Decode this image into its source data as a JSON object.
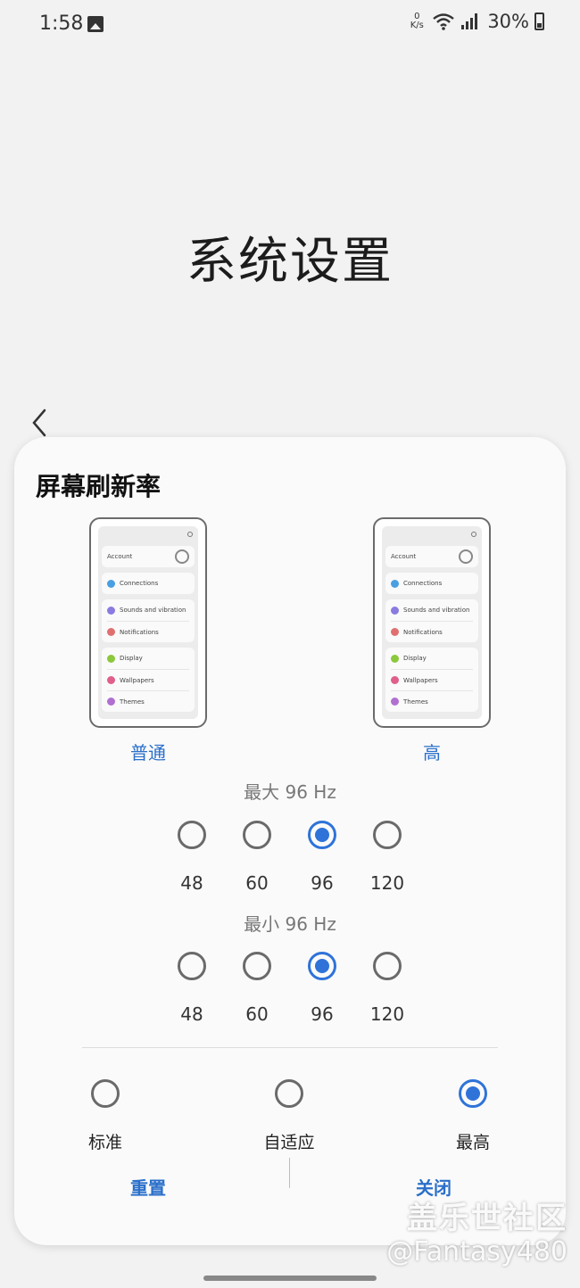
{
  "status_bar": {
    "time": "1:58",
    "speed_value": "0",
    "speed_unit": "K/s",
    "battery": "30%"
  },
  "page": {
    "title": "系统设置"
  },
  "sheet": {
    "title": "屏幕刷新率",
    "previews": [
      {
        "label": "普通",
        "rows": [
          "Account",
          "Connections",
          "Sounds and vibration",
          "Notifications",
          "Display",
          "Wallpapers",
          "Themes"
        ]
      },
      {
        "label": "高",
        "rows": [
          "Account",
          "Connections",
          "Sounds and vibration",
          "Notifications",
          "Display",
          "Wallpapers",
          "Themes"
        ]
      }
    ],
    "max_caption": "最大 96 Hz",
    "min_caption": "最小 96 Hz",
    "max_options": [
      "48",
      "60",
      "96",
      "120"
    ],
    "min_options": [
      "48",
      "60",
      "96",
      "120"
    ],
    "max_selected": "96",
    "min_selected": "96",
    "modes": [
      "标准",
      "自适应",
      "最高"
    ],
    "mode_selected": "最高",
    "reset_label": "重置",
    "close_label": "关闭"
  },
  "watermark": {
    "line1": "盖乐世社区",
    "line2": "@Fantasy480"
  },
  "colors": {
    "accent": "#2f73d9",
    "link": "#2a6fc9",
    "background": "#f2f2f2",
    "sheet": "#fafafa"
  },
  "icons": [
    "image-icon",
    "wifi-icon",
    "signal-icon",
    "battery-icon",
    "back-chevron-icon",
    "search-icon"
  ]
}
